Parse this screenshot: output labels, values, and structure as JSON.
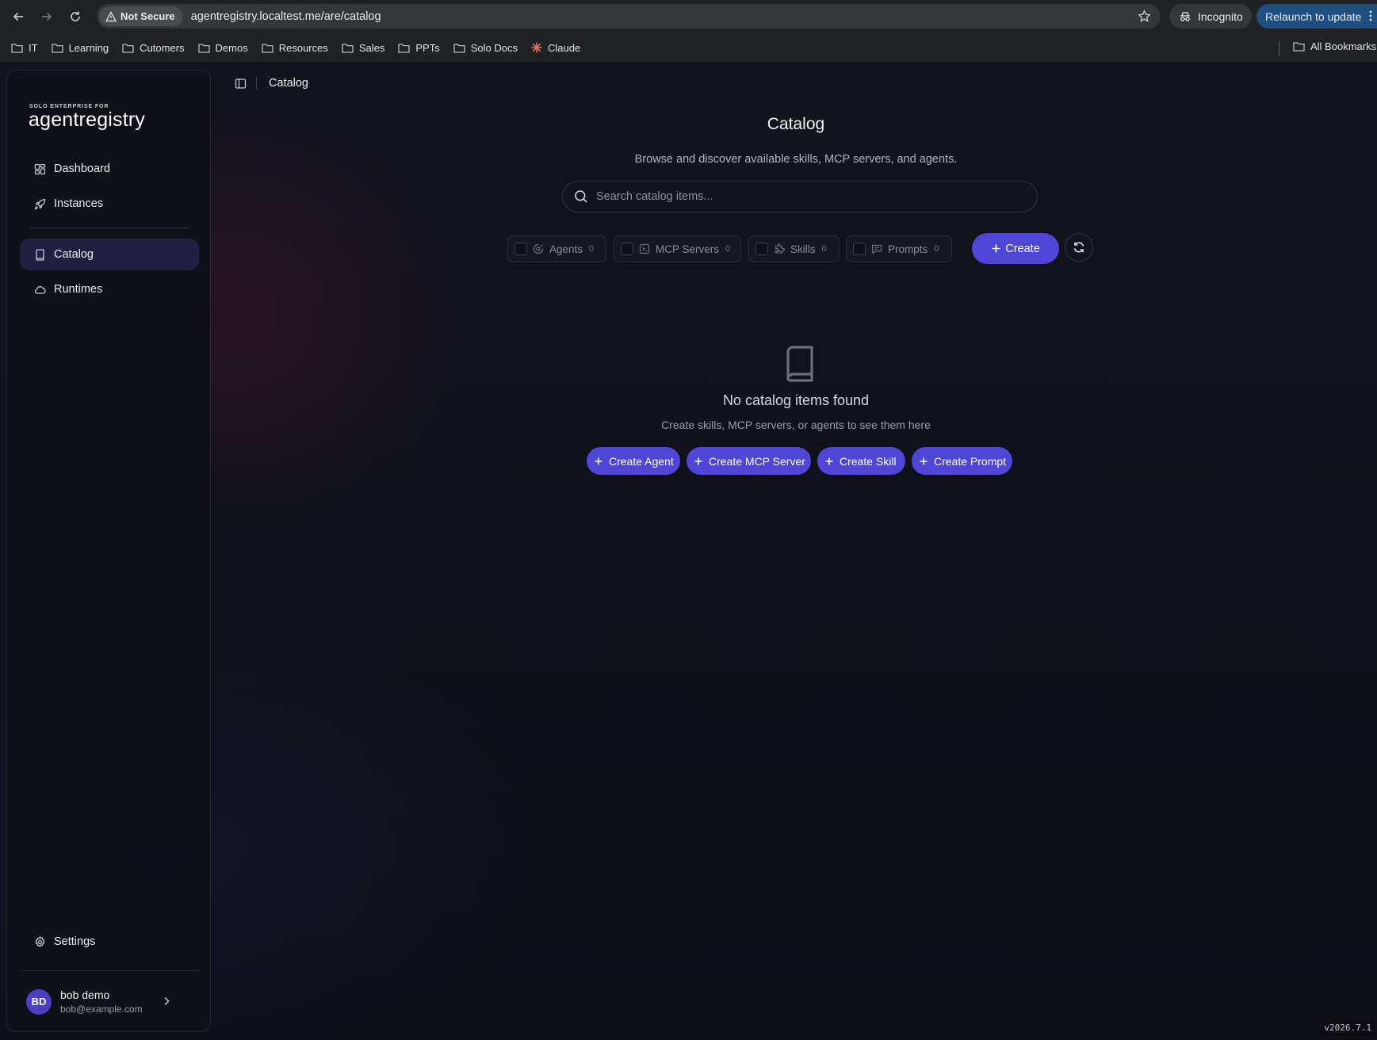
{
  "browser": {
    "security_label": "Not Secure",
    "url": "agentregistry.localtest.me/are/catalog",
    "incognito_label": "Incognito",
    "relaunch_label": "Relaunch to update",
    "bookmarks": [
      "IT",
      "Learning",
      "Cutomers",
      "Demos",
      "Resources",
      "Sales",
      "PPTs",
      "Solo Docs",
      "Claude"
    ],
    "all_bookmarks_label": "All Bookmarks",
    "colors": {
      "chrome": "#202124",
      "omnibox": "#35363a",
      "relaunch": "#1f4f80"
    }
  },
  "sidebar": {
    "brand_small": "SOLO ENTERPRISE FOR",
    "brand": "agentregistry",
    "items": [
      {
        "label": "Dashboard",
        "icon": "dashboard-icon"
      },
      {
        "label": "Instances",
        "icon": "rocket-icon"
      },
      {
        "label": "Catalog",
        "icon": "book-icon",
        "active": true
      },
      {
        "label": "Runtimes",
        "icon": "cloud-icon"
      }
    ],
    "settings_label": "Settings",
    "user": {
      "initials": "BD",
      "name": "bob demo",
      "email": "bob@example.com"
    }
  },
  "header": {
    "breadcrumb": "Catalog"
  },
  "main": {
    "title": "Catalog",
    "subtitle": "Browse and discover available skills, MCP servers, and agents.",
    "search_placeholder": "Search catalog items...",
    "filters": [
      {
        "label": "Agents",
        "count": "0",
        "icon": "agent-icon"
      },
      {
        "label": "MCP Servers",
        "count": "0",
        "icon": "server-icon"
      },
      {
        "label": "Skills",
        "count": "0",
        "icon": "puzzle-icon"
      },
      {
        "label": "Prompts",
        "count": "0",
        "icon": "message-icon"
      }
    ],
    "create_label": "Create",
    "empty": {
      "title": "No catalog items found",
      "subtitle": "Create skills, MCP servers, or agents to see them here",
      "actions": [
        "Create Agent",
        "Create MCP Server",
        "Create Skill",
        "Create Prompt"
      ]
    },
    "accent_color": "#4f45d6"
  },
  "version": "v2026.7.1"
}
